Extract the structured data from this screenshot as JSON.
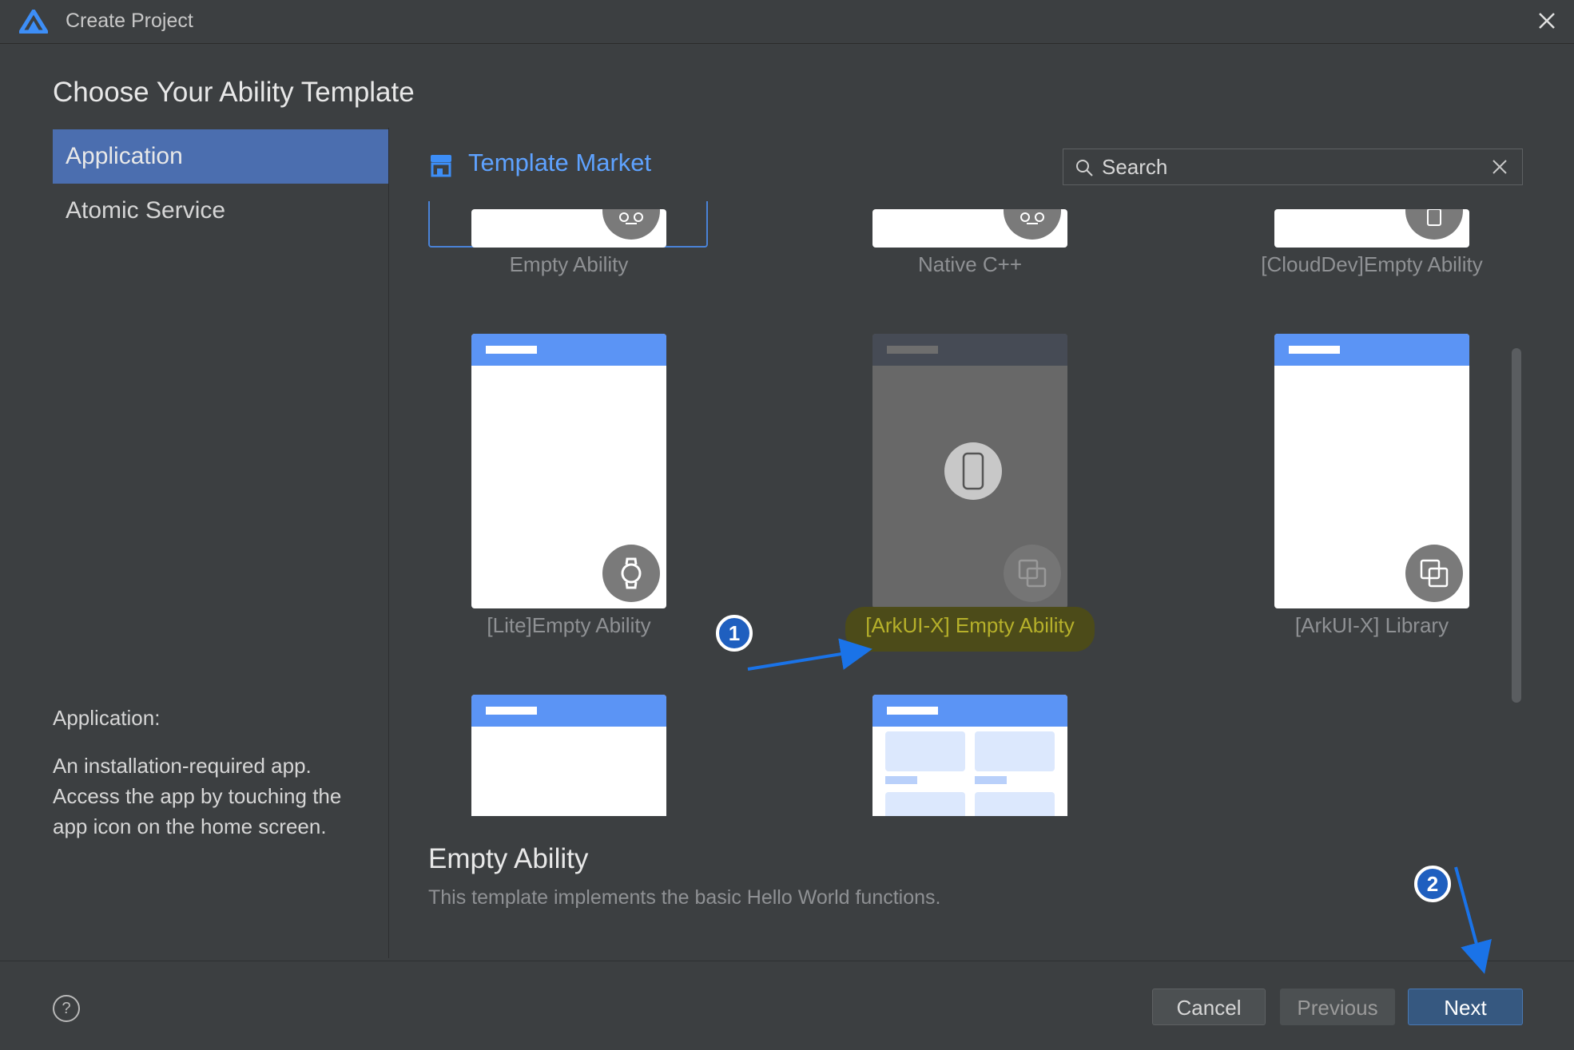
{
  "window": {
    "title": "Create Project",
    "colors": {
      "accent": "#4b6eaf",
      "link": "#5ea2ff",
      "card_header": "#5b94f5",
      "highlight": "#4d4c17",
      "annotation": "#1f5fbf"
    }
  },
  "heading": "Choose Your Ability Template",
  "sidebar": {
    "items": [
      {
        "label": "Application",
        "active": true
      },
      {
        "label": "Atomic Service",
        "active": false
      }
    ],
    "description": {
      "title": "Application:",
      "lines": [
        "An installation-required app.",
        "Access the app by touching the",
        "app icon on the home screen."
      ]
    }
  },
  "market": {
    "label": "Template Market",
    "icon": "store-icon"
  },
  "search": {
    "placeholder": "Search",
    "value": "",
    "icon": "search-icon",
    "clear_icon": "close-icon"
  },
  "templates": [
    {
      "label": "Empty Ability",
      "badge_icon": "face-icon",
      "selected": true
    },
    {
      "label": "Native C++",
      "badge_icon": "face-icon"
    },
    {
      "label": "[CloudDev]Empty Ability",
      "badge_icon": "cloud-device-icon"
    },
    {
      "label": "[Lite]Empty Ability",
      "badge_icon": "watch-icon"
    },
    {
      "label": "[ArkUI-X] Empty Ability",
      "badge_icon": "copy-icon",
      "center_icon": "phone-icon",
      "highlighted": true
    },
    {
      "label": "[ArkUI-X] Library",
      "badge_icon": "copy-icon"
    },
    {
      "label": "",
      "layout": "plain"
    },
    {
      "label": "",
      "layout": "grid"
    }
  ],
  "detail": {
    "title": "Empty Ability",
    "description": "This template implements the basic Hello World functions."
  },
  "footer": {
    "help": "?",
    "cancel": "Cancel",
    "previous": "Previous",
    "next": "Next"
  },
  "annotations": {
    "step1": "1",
    "step2": "2"
  }
}
